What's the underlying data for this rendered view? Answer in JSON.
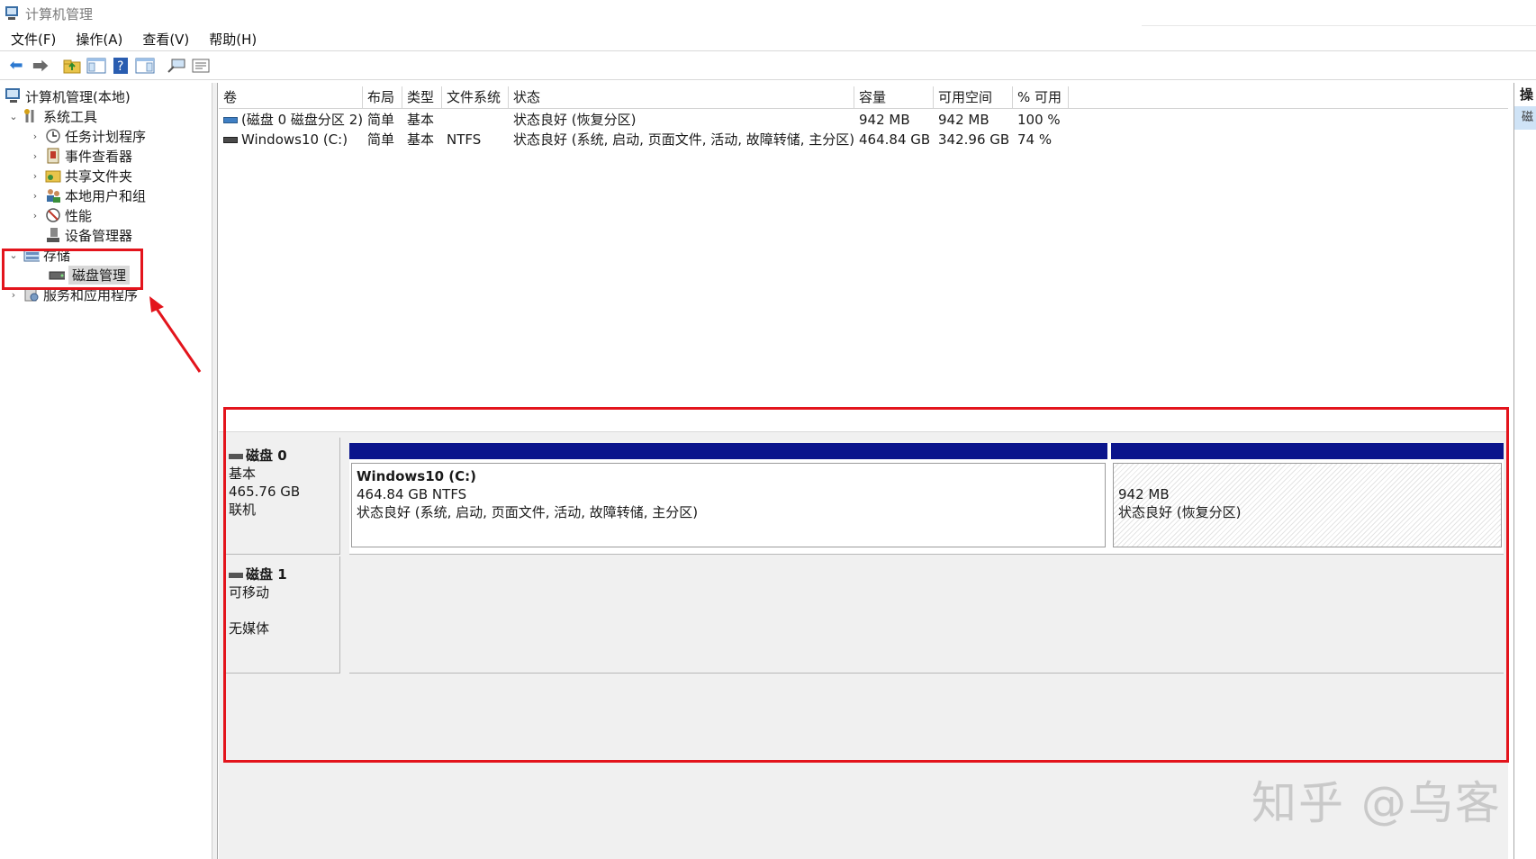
{
  "window": {
    "title": "计算机管理"
  },
  "menu": [
    "文件(F)",
    "操作(A)",
    "查看(V)",
    "帮助(H)"
  ],
  "toolbar": {
    "icons": [
      "back-arrow-icon",
      "forward-arrow-icon",
      "up-folder-icon",
      "console-tree-icon",
      "help-icon",
      "show-hide-action-pane-icon",
      "connect-icon",
      "properties-icon"
    ]
  },
  "tree": {
    "root": "计算机管理(本地)",
    "system_tools": "系统工具",
    "task_scheduler": "任务计划程序",
    "event_viewer": "事件查看器",
    "shared_folders": "共享文件夹",
    "local_users": "本地用户和组",
    "performance": "性能",
    "device_manager": "设备管理器",
    "storage": "存储",
    "disk_management": "磁盘管理",
    "services_apps": "服务和应用程序"
  },
  "actions": {
    "header": "操",
    "item": "磁"
  },
  "volume_list": {
    "columns": [
      "卷",
      "布局",
      "类型",
      "文件系统",
      "状态",
      "容量",
      "可用空间",
      "% 可用"
    ],
    "rows": [
      {
        "volume": "(磁盘 0 磁盘分区 2)",
        "layout": "简单",
        "type": "基本",
        "fs": "",
        "status": "状态良好 (恢复分区)",
        "capacity": "942 MB",
        "free": "942 MB",
        "pct": "100 %"
      },
      {
        "volume": "Windows10 (C:)",
        "layout": "简单",
        "type": "基本",
        "fs": "NTFS",
        "status": "状态良好 (系统, 启动, 页面文件, 活动, 故障转储, 主分区)",
        "capacity": "464.84 GB",
        "free": "342.96 GB",
        "pct": "74 %"
      }
    ]
  },
  "disks": [
    {
      "name": "磁盘 0",
      "kind": "基本",
      "size": "465.76 GB",
      "state": "联机",
      "partitions": [
        {
          "name": "Windows10  (C:)",
          "size_fs": "464.84 GB NTFS",
          "status": "状态良好 (系统, 启动, 页面文件, 活动, 故障转储, 主分区)"
        },
        {
          "name": "",
          "size_fs": "942 MB",
          "status": "状态良好 (恢复分区)"
        }
      ]
    },
    {
      "name": "磁盘 1",
      "kind": "可移动",
      "media": "无媒体"
    }
  ],
  "watermark": "知乎 @乌客",
  "colors": {
    "partition_bar": "#0a148c",
    "annotation": "#e3141c",
    "selection": "#d9d9d9"
  }
}
